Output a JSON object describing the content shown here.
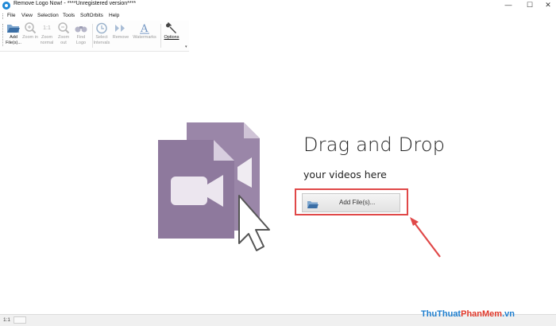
{
  "window": {
    "title": "Remove Logo Now! - ****Unregistered version****",
    "minimize_glyph": "—",
    "maximize_glyph": "☐",
    "close_glyph": "✕"
  },
  "menu": [
    "File",
    "View",
    "Selection",
    "Tools",
    "SoftOrbits",
    "Help"
  ],
  "toolbar": {
    "tools": [
      {
        "label": "Add File(s)...",
        "icon": "folder-open-icon",
        "active": true
      },
      {
        "label": "Zoom in",
        "icon": "zoom-in-icon",
        "active": false
      },
      {
        "label": "Zoom normal",
        "icon": "zoom-normal-icon",
        "active": false
      },
      {
        "label": "Zoom out",
        "icon": "zoom-out-icon",
        "active": false
      },
      {
        "label": "Find Logo",
        "icon": "binoculars-icon",
        "active": false
      },
      {
        "label": "Select Intervals",
        "icon": "clock-icon",
        "active": false
      },
      {
        "label": "Remove",
        "icon": "arrows-icon",
        "active": false
      },
      {
        "label": "Watermarks",
        "icon": "letter-a-icon",
        "active": false
      },
      {
        "label": "Options",
        "icon": "wrench-icon",
        "active": true
      }
    ],
    "zoom_normal_text": "1:1"
  },
  "drop_zone": {
    "title": "Drag and Drop",
    "subtitle": "your videos here",
    "button_label": "Add File(s)..."
  },
  "status": {
    "zoom": "1:1"
  },
  "watermark": {
    "part1": "ThuThuat",
    "part2": "PhanMem",
    "part3": ".vn"
  },
  "colors": {
    "illustration": "#9d88a8",
    "illustration_dark": "#8a759a",
    "highlight_red": "#e04848",
    "watermark_blue": "#1f7fcf",
    "watermark_red": "#e0392b"
  }
}
